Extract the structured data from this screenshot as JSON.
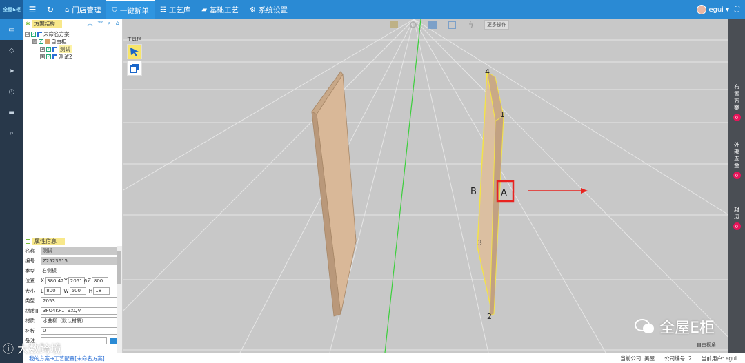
{
  "topbar": {
    "logo_text": "全屋E柜",
    "nav": [
      {
        "icon": "home-outline-icon",
        "label": "门店管理"
      },
      {
        "icon": "shield-check-icon",
        "label": "一键拆单"
      },
      {
        "icon": "library-icon",
        "label": "工艺库"
      },
      {
        "icon": "folder-icon",
        "label": "基础工艺"
      },
      {
        "icon": "gear-icon",
        "label": "系统设置"
      }
    ],
    "user": "egui",
    "user_caret": "▾",
    "fullscreen_glyph": "⛶"
  },
  "left_panel": {
    "tree_title": "方案结构",
    "tree": [
      {
        "indent": 0,
        "toggle": "⊟",
        "label": "未命名方案"
      },
      {
        "indent": 1,
        "toggle": "⊟",
        "label": "自由柜"
      },
      {
        "indent": 2,
        "toggle": "⊞",
        "label": "测试"
      },
      {
        "indent": 2,
        "toggle": "⊞",
        "label": "测试2"
      }
    ],
    "props_title": "属性信息",
    "props": {
      "name_label": "名称",
      "name_value": "测试",
      "code_label": "编号",
      "code_value": "Z2523615",
      "type_label": "类型",
      "type_value": "右侧板",
      "pos_label": "位置",
      "pos_x_label": "X",
      "pos_x": "380.42",
      "pos_y_label": "Y",
      "pos_y": "2051.6",
      "pos_z_label": "Z",
      "pos_z": "800",
      "size_label": "大小",
      "size_l_label": "L",
      "size_l": "800",
      "size_w_label": "W",
      "size_w": "500",
      "size_h_label": "H",
      "size_h": "18",
      "kind_label": "类型",
      "kind_value": "2053",
      "mat_id_label": "材质II",
      "mat_id_value": "3FO4KF1T9XQV",
      "mat_label": "材质",
      "mat_value": "水曲柳（默认材质）",
      "patch_label": "补板",
      "patch_value": "0",
      "note_label": "备注",
      "note_value": ""
    }
  },
  "viewport": {
    "toolbar_label": "工具栏",
    "more_label": "更多操作",
    "view_mode": "自由视角",
    "labels": {
      "n1": "1",
      "n2": "2",
      "n3": "3",
      "n4": "4",
      "a": "A",
      "b": "B"
    },
    "watermark": "全屋E柜",
    "bottom_watermark": "大数跨境"
  },
  "right_rail": [
    {
      "label": "布置方案",
      "count": "0"
    },
    {
      "label": "外部五金",
      "count": "0"
    },
    {
      "label": "封边",
      "count": "0"
    }
  ],
  "footer": {
    "crumb": "我的方案→工艺配置[未命名方案]",
    "company_label": "当前公司:",
    "company": "美屋",
    "company_no_label": "公司编号:",
    "company_no": "2",
    "user_label": "当前用户:",
    "user": "egui"
  },
  "colors": {
    "primary": "#2a8ad4",
    "rail": "#28384a",
    "board": "#dbbfa1",
    "highlight": "#f2e24a",
    "red": "#e8231f"
  }
}
